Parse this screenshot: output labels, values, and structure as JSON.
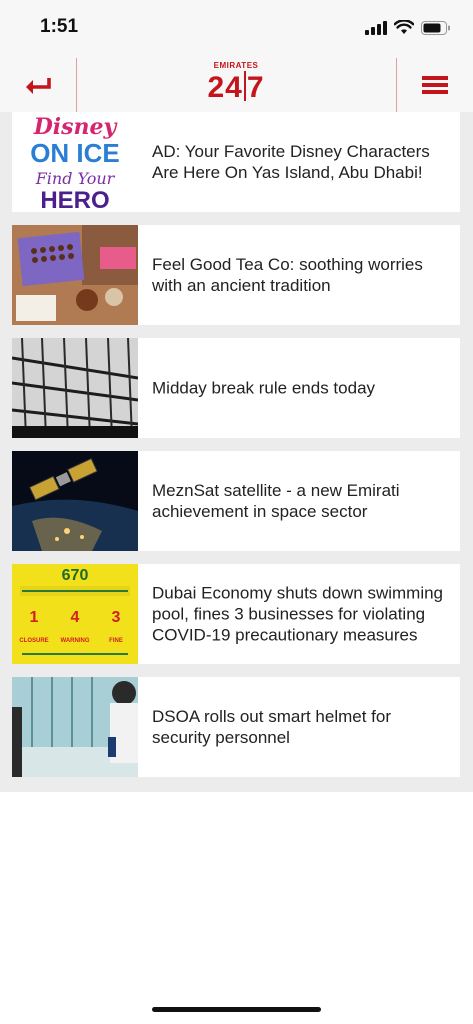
{
  "status": {
    "time": "1:51"
  },
  "header": {
    "logo_top": "EMIRATES",
    "logo_left": "24",
    "logo_right": "7",
    "back_icon": "back-arrow-icon",
    "menu_icon": "hamburger-menu-icon"
  },
  "articles": [
    {
      "title": "AD: Your Favorite Disney Characters Are Here On Yas Island, Abu Dhabi!",
      "thumb_line1": "Disney",
      "thumb_line2": "ON ICE",
      "thumb_line3": "Find Your",
      "thumb_line4": "HERO"
    },
    {
      "title": "Feel Good Tea Co: soothing worries with an ancient tradition"
    },
    {
      "title": "Midday break rule ends today"
    },
    {
      "title": "MeznSat satellite - a new Emirati achievement in space sector"
    },
    {
      "title": "Dubai Economy shuts down swimming pool, fines 3 businesses for violating COVID-19 precautionary measures",
      "thumb_number": "670",
      "thumb_counts": [
        "1",
        "4",
        "3"
      ],
      "thumb_labels": [
        "CLOSURE",
        "WARNING",
        "FINE"
      ]
    },
    {
      "title": "DSOA rolls out smart helmet for security personnel"
    }
  ],
  "colors": {
    "brand_red": "#c3161c",
    "feed_bg": "#ececec"
  }
}
